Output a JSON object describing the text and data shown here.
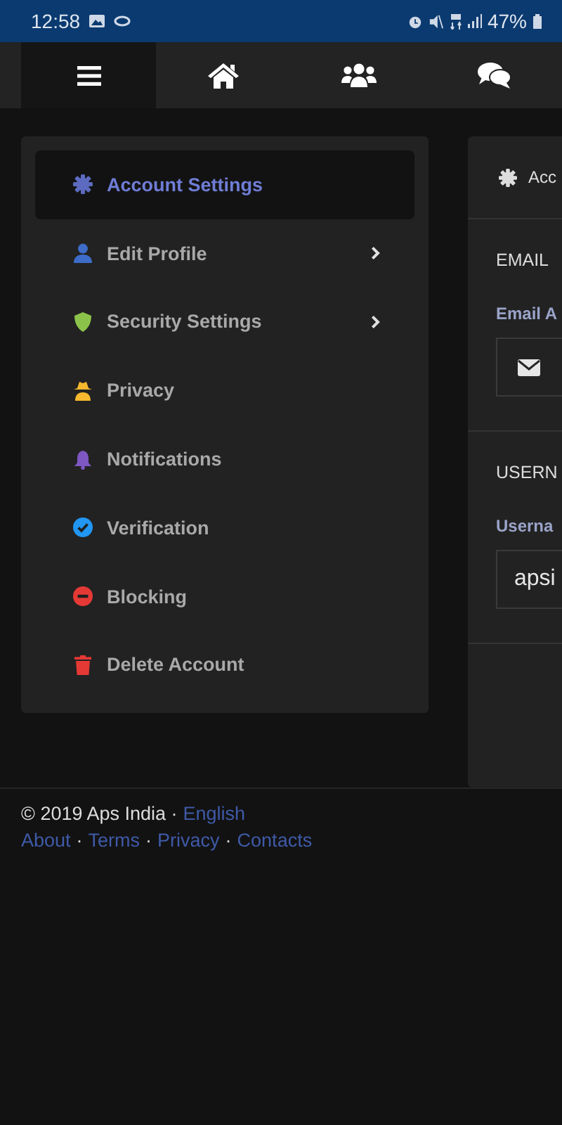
{
  "status_bar": {
    "time": "12:58",
    "battery": "47%"
  },
  "nav": {
    "tabs": [
      {
        "selected": true
      },
      {
        "selected": false
      },
      {
        "selected": false
      },
      {
        "selected": false
      }
    ]
  },
  "sidebar": {
    "items": [
      {
        "label": "Account Settings",
        "selected": true,
        "kind": "link",
        "color": "#5c6bc0"
      },
      {
        "label": "Edit Profile",
        "selected": false,
        "kind": "submenu",
        "color": "#3d6cc9"
      },
      {
        "label": "Security Settings",
        "selected": false,
        "kind": "submenu",
        "color": "#8bc34a"
      },
      {
        "label": "Privacy",
        "selected": false,
        "kind": "link",
        "color": "#f5b82e"
      },
      {
        "label": "Notifications",
        "selected": false,
        "kind": "link",
        "color": "#7e57c2"
      },
      {
        "label": "Verification",
        "selected": false,
        "kind": "link",
        "color": "#2196f3"
      },
      {
        "label": "Blocking",
        "selected": false,
        "kind": "link",
        "color": "#e53935"
      },
      {
        "label": "Delete Account",
        "selected": false,
        "kind": "link",
        "color": "#e53935"
      }
    ]
  },
  "panel": {
    "title": "Acc",
    "sections": [
      {
        "heading": "EMAIL",
        "label": "Email A",
        "kind": "icon_input"
      },
      {
        "heading": "USERN",
        "label": "Userna",
        "kind": "text_input",
        "value": "apsi"
      }
    ]
  },
  "footer": {
    "copyright": "© 2019 Aps India ·",
    "language": "English",
    "separator": "·",
    "links": [
      "About",
      "Terms",
      "Privacy",
      "Contacts"
    ]
  }
}
